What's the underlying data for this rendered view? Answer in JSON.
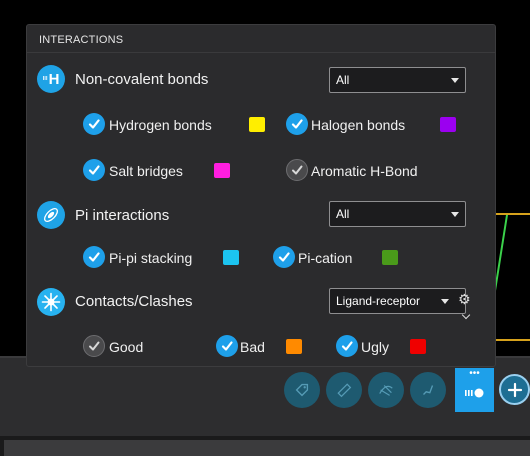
{
  "panel": {
    "title": "INTERACTIONS"
  },
  "noncovalent": {
    "icon_text": "H",
    "label": "Non-covalent bonds",
    "select_value": "All",
    "items": [
      {
        "label": "Hydrogen bonds",
        "checked": true,
        "color": "#ffee00"
      },
      {
        "label": "Halogen bonds",
        "checked": true,
        "color": "#9b00f0"
      },
      {
        "label": "Salt bridges",
        "checked": true,
        "color": "#ff1ee0"
      },
      {
        "label": "Aromatic H-Bond",
        "checked": false,
        "color": ""
      }
    ]
  },
  "pi": {
    "label": "Pi interactions",
    "select_value": "All",
    "items": [
      {
        "label": "Pi-pi stacking",
        "checked": true,
        "color": "#1cc4f0"
      },
      {
        "label": "Pi-cation",
        "checked": true,
        "color": "#4a9a1a"
      }
    ]
  },
  "contacts": {
    "label": "Contacts/Clashes",
    "select_value": "Ligand-receptor",
    "items": [
      {
        "label": "Good",
        "checked": false,
        "color": ""
      },
      {
        "label": "Bad",
        "checked": true,
        "color": "#ff8a00"
      },
      {
        "label": "Ugly",
        "checked": true,
        "color": "#f00000"
      }
    ]
  },
  "toolbar": {
    "tools": [
      "tag-icon",
      "ruler-icon",
      "surface-icon",
      "bonds-icon",
      "interactions-icon"
    ],
    "active_tool": "interactions-icon",
    "add_icon": "plus-icon"
  }
}
